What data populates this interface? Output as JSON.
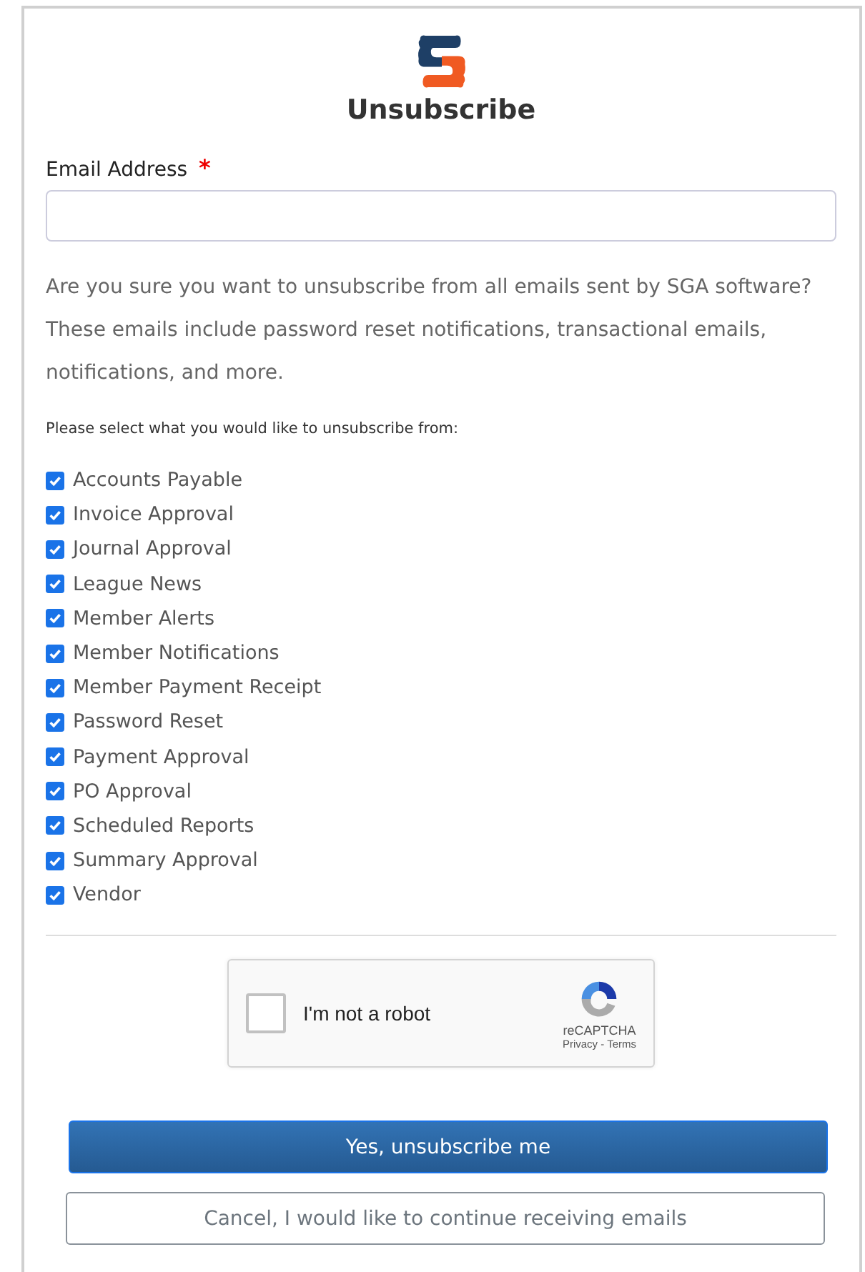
{
  "title": "Unsubscribe",
  "email": {
    "label": "Email Address",
    "required_mark": "*"
  },
  "intro": "Are you sure you want to unsubscribe from all emails sent by SGA software? These emails include password reset notifications, transactional emails, notifications, and more.",
  "select_prompt": "Please select what you would like to unsubscribe from:",
  "options": [
    {
      "label": "Accounts Payable",
      "checked": true
    },
    {
      "label": "Invoice Approval",
      "checked": true
    },
    {
      "label": "Journal Approval",
      "checked": true
    },
    {
      "label": "League News",
      "checked": true
    },
    {
      "label": "Member Alerts",
      "checked": true
    },
    {
      "label": "Member Notifications",
      "checked": true
    },
    {
      "label": "Member Payment Receipt",
      "checked": true
    },
    {
      "label": "Password Reset",
      "checked": true
    },
    {
      "label": "Payment Approval",
      "checked": true
    },
    {
      "label": "PO Approval",
      "checked": true
    },
    {
      "label": "Scheduled Reports",
      "checked": true
    },
    {
      "label": "Summary Approval",
      "checked": true
    },
    {
      "label": "Vendor",
      "checked": true
    }
  ],
  "captcha": {
    "label": "I'm not a robot",
    "checked": false,
    "brand": "reCAPTCHA",
    "privacy": "Privacy",
    "separator": "-",
    "terms": "Terms"
  },
  "buttons": {
    "confirm": "Yes, unsubscribe me",
    "cancel": "Cancel, I would like to continue receiving emails"
  }
}
